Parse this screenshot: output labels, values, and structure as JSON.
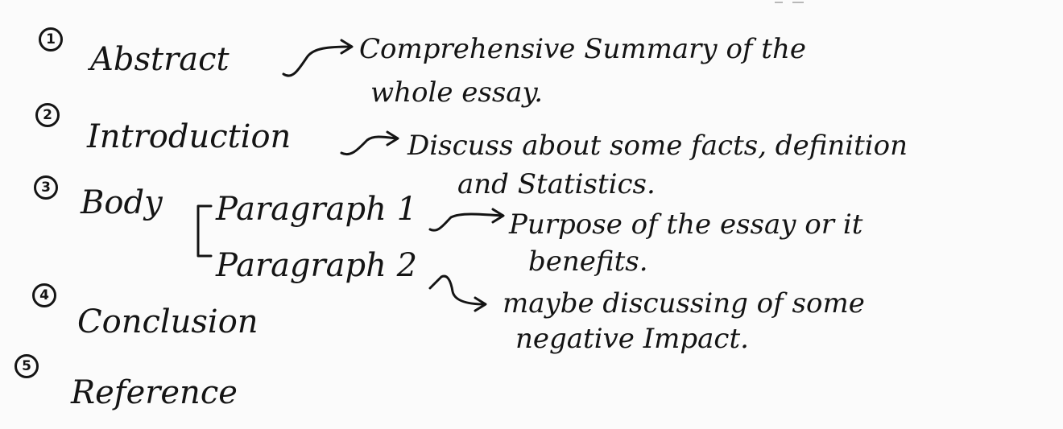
{
  "sections": [
    {
      "number": "1",
      "title": "Abstract",
      "note_lines": [
        "Comprehensive Summary of the",
        "whole essay."
      ]
    },
    {
      "number": "2",
      "title": "Introduction",
      "note_lines": [
        "Discuss about some facts, definition",
        "and Statistics."
      ]
    },
    {
      "number": "3",
      "title": "Body",
      "paragraphs": [
        {
          "label": "Paragraph 1",
          "note_lines": [
            "Purpose of the essay or it",
            "benefits."
          ]
        },
        {
          "label": "Paragraph 2",
          "note_lines": [
            "maybe discussing of some",
            "negative Impact."
          ]
        }
      ]
    },
    {
      "number": "4",
      "title": "Conclusion"
    },
    {
      "number": "5",
      "title": "Reference"
    }
  ]
}
